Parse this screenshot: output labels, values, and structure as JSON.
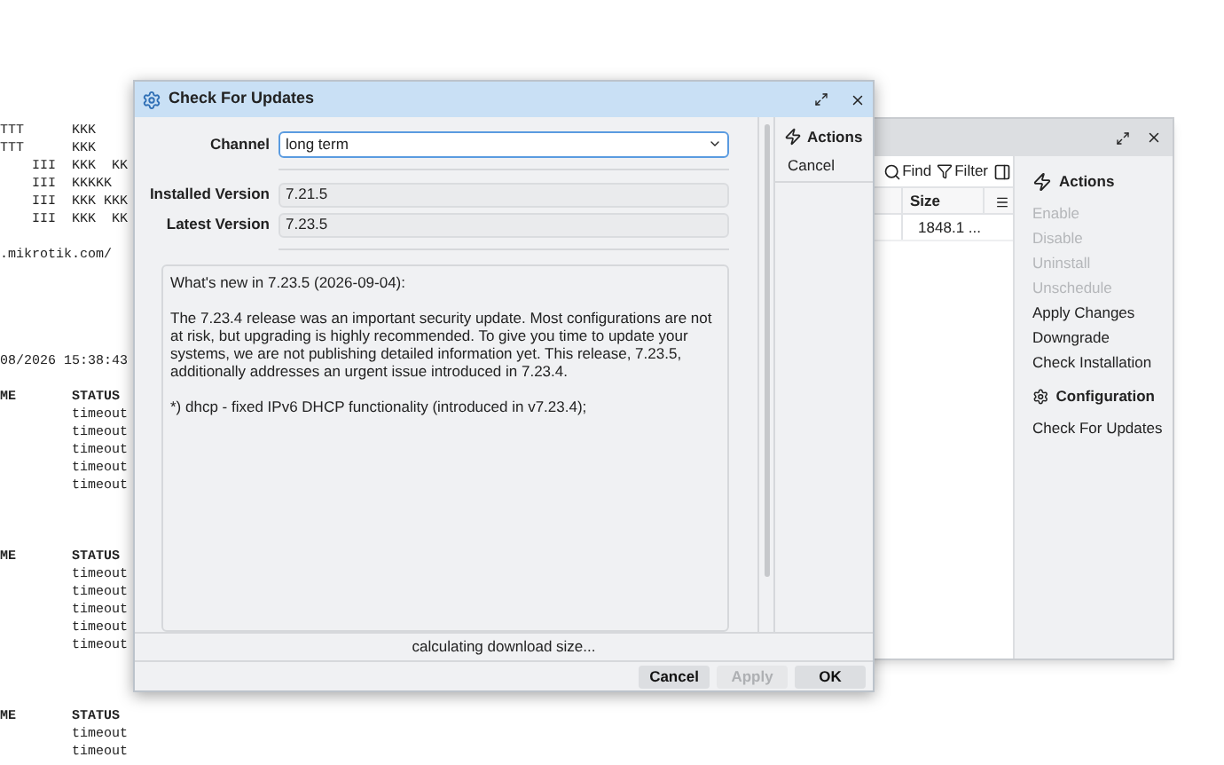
{
  "terminal": {
    "lines": [
      {
        "kind": "text",
        "text": "TTT      KKK"
      },
      {
        "kind": "text",
        "text": "TTT      KKK"
      },
      {
        "kind": "text",
        "text": "    III  KKK  KK"
      },
      {
        "kind": "text",
        "text": "    III  KKKKK"
      },
      {
        "kind": "text",
        "text": "    III  KKK KKK"
      },
      {
        "kind": "text",
        "text": "    III  KKK  KK"
      },
      {
        "kind": "blank"
      },
      {
        "kind": "text",
        "text": ".mikrotik.com/"
      },
      {
        "kind": "blank"
      },
      {
        "kind": "blank"
      },
      {
        "kind": "blank"
      },
      {
        "kind": "blank"
      },
      {
        "kind": "blank"
      },
      {
        "kind": "text",
        "text": "08/2026 15:38:43"
      },
      {
        "kind": "blank"
      },
      {
        "kind": "header",
        "text": "ME       STATUS"
      },
      {
        "kind": "text",
        "text": "         timeout"
      },
      {
        "kind": "text",
        "text": "         timeout"
      },
      {
        "kind": "text",
        "text": "         timeout"
      },
      {
        "kind": "text",
        "text": "         timeout"
      },
      {
        "kind": "text",
        "text": "         timeout"
      },
      {
        "kind": "blank"
      },
      {
        "kind": "blank"
      },
      {
        "kind": "blank"
      },
      {
        "kind": "header",
        "text": "ME       STATUS"
      },
      {
        "kind": "text",
        "text": "         timeout"
      },
      {
        "kind": "text",
        "text": "         timeout"
      },
      {
        "kind": "text",
        "text": "         timeout"
      },
      {
        "kind": "text",
        "text": "         timeout"
      },
      {
        "kind": "text",
        "text": "         timeout"
      },
      {
        "kind": "blank"
      },
      {
        "kind": "blank"
      },
      {
        "kind": "blank"
      },
      {
        "kind": "header",
        "text": "ME       STATUS"
      },
      {
        "kind": "text",
        "text": "         timeout"
      },
      {
        "kind": "text",
        "text": "         timeout"
      }
    ]
  },
  "back_window": {
    "toolbar": [
      {
        "kind": "search",
        "label": "Find"
      },
      {
        "kind": "filter",
        "label": "Filter"
      }
    ],
    "table": {
      "columns": [
        "Size"
      ],
      "rows": [
        [
          "1848.1 ..."
        ]
      ]
    },
    "sidebar": [
      {
        "kind": "actions",
        "title": "Actions",
        "items": [
          {
            "label": "Enable",
            "disabled": true
          },
          {
            "label": "Disable",
            "disabled": true
          },
          {
            "label": "Uninstall",
            "disabled": true
          },
          {
            "label": "Unschedule",
            "disabled": true
          },
          {
            "label": "Apply Changes",
            "disabled": false
          },
          {
            "label": "Downgrade",
            "disabled": false
          },
          {
            "label": "Check Installation",
            "disabled": false
          }
        ]
      },
      {
        "kind": "configuration",
        "title": "Configuration",
        "items": [
          {
            "label": "Check For Updates",
            "disabled": false
          }
        ]
      }
    ]
  },
  "dialog": {
    "title": "Check For Updates",
    "fields": [
      {
        "kind": "select",
        "label": "Channel",
        "value": "long term"
      },
      {
        "kind": "separator"
      },
      {
        "kind": "readonly",
        "label": "Installed Version",
        "value": "7.21.5"
      },
      {
        "kind": "readonly",
        "label": "Latest Version",
        "value": "7.23.5"
      },
      {
        "kind": "separator"
      }
    ],
    "notes": [
      "What's new in 7.23.5 (2026-09-04):",
      "The 7.23.4 release was an important security update. Most configurations are not at risk, but upgrading is highly recommended. To give you time to update your systems, we are not publishing detailed information yet. This release, 7.23.5, additionally addresses an urgent issue introduced in 7.23.4.",
      "*) dhcp - fixed IPv6 DHCP functionality (introduced in v7.23.4);"
    ],
    "status": "calculating download size...",
    "actions": {
      "title": "Actions",
      "items": [
        "Cancel"
      ]
    },
    "buttons": [
      {
        "label": "Cancel",
        "disabled": false
      },
      {
        "label": "Apply",
        "disabled": true
      },
      {
        "label": "OK",
        "disabled": false
      }
    ]
  }
}
